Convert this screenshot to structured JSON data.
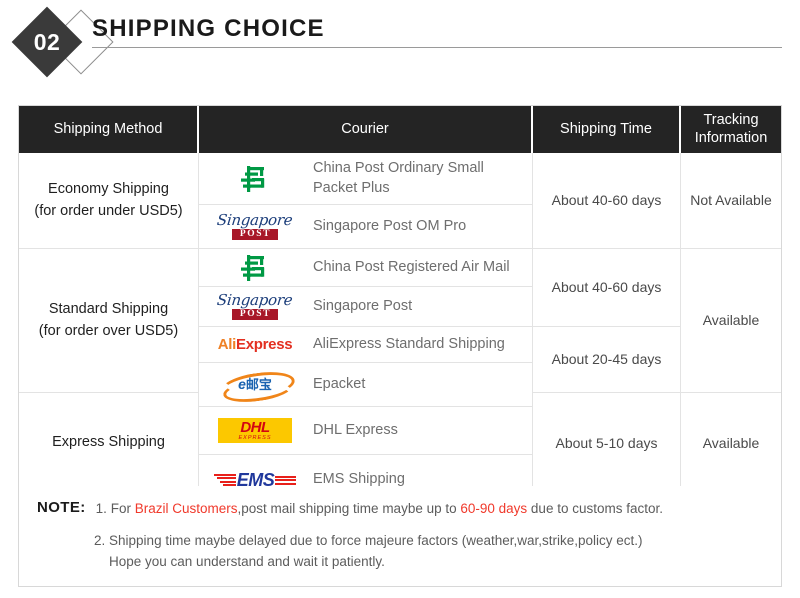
{
  "header": {
    "badge_number": "02",
    "title": "SHIPPING CHOICE"
  },
  "table": {
    "columns": [
      {
        "key": "method",
        "label": "Shipping Method"
      },
      {
        "key": "courier",
        "label": "Courier"
      },
      {
        "key": "time",
        "label": "Shipping Time"
      },
      {
        "key": "track",
        "label": "Tracking Information"
      }
    ],
    "methods": [
      {
        "line1": "Economy Shipping",
        "line2": "(for order under USD5)"
      },
      {
        "line1": "Standard Shipping",
        "line2": "(for order over USD5)"
      },
      {
        "line1": "Express Shipping",
        "line2": ""
      }
    ],
    "couriers": [
      {
        "logo": "china-post-logo",
        "name": "China Post Ordinary Small Packet Plus"
      },
      {
        "logo": "singapore-post-logo",
        "name": "Singapore Post OM Pro"
      },
      {
        "logo": "china-post-logo",
        "name": "China Post Registered Air Mail"
      },
      {
        "logo": "singapore-post-logo",
        "name": "Singapore Post"
      },
      {
        "logo": "aliexpress-logo",
        "name": "AliExpress Standard Shipping"
      },
      {
        "logo": "epacket-logo",
        "name": "Epacket"
      },
      {
        "logo": "dhl-logo",
        "name": "DHL Express"
      },
      {
        "logo": "ems-logo",
        "name": "EMS Shipping"
      }
    ],
    "shipping_times": [
      "About 40-60 days",
      "About 40-60 days",
      "About 20-45 days",
      "About 5-10 days"
    ],
    "tracking": [
      "Not Available",
      "Available",
      "Available"
    ]
  },
  "note": {
    "label": "NOTE:",
    "item1": {
      "num": "1.",
      "pre": "For ",
      "highlight1": "Brazil Customers",
      "mid": ",post mail shipping time maybe up to ",
      "highlight2": "60-90 days",
      "post": " due to customs factor."
    },
    "item2": {
      "num": "2.",
      "line1": "Shipping time maybe delayed due to force majeure factors (weather,war,strike,policy ect.)",
      "line2": "Hope you can understand and wait it patiently."
    }
  },
  "logos": {
    "singapore_script": "Singapore",
    "singapore_post": "POST",
    "aliexpress_ali": "Ali",
    "aliexpress_express": "Express",
    "dhl_main": "DHL",
    "dhl_sub": "EXPRESS",
    "ems_text": "EMS",
    "epacket_e": "e",
    "epacket_cn": "邮宝"
  },
  "colors": {
    "header_bar": "#242424",
    "badge": "#3a3a3a",
    "china_post_green": "#009944",
    "singapore_blue": "#1b3d7a",
    "singapore_red": "#a81728",
    "ali_orange": "#ef8125",
    "ali_red": "#e32f20",
    "dhl_yellow": "#fcc800",
    "dhl_red": "#d40511",
    "ems_blue": "#20389c",
    "ems_red": "#e8201a",
    "epacket_orange": "#f08519",
    "note_highlight": "#f0392b"
  }
}
